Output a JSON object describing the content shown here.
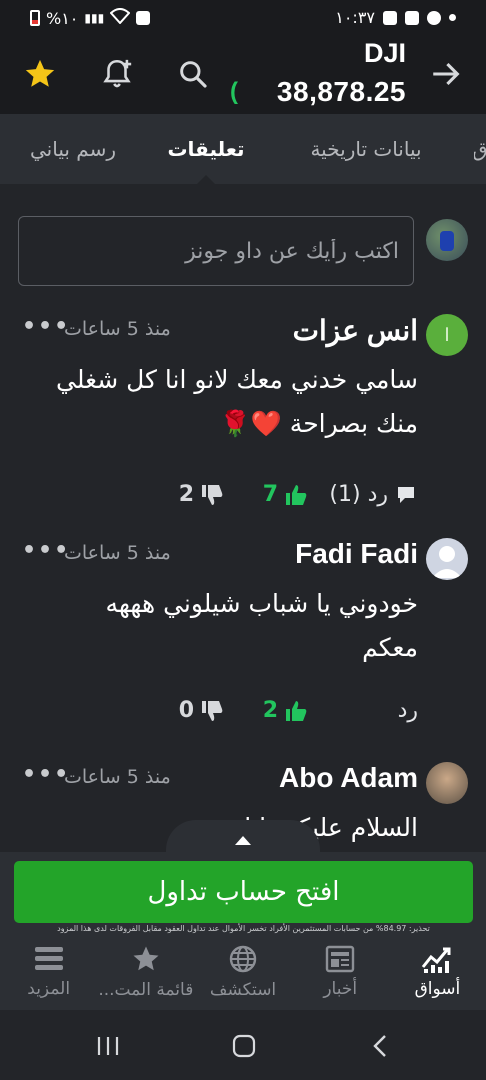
{
  "status_bar": {
    "time": "١٠:٣٧",
    "battery": "%١٠"
  },
  "header": {
    "instrument": "DJI",
    "price": "38,878.25",
    "price_indicator": "(",
    "colors": {
      "up": "#22c55e",
      "star": "#f5c518",
      "background": "#1a1b1e"
    },
    "icons": [
      "star-icon",
      "add-alert-bell-icon",
      "search-icon",
      "arrow-forward-icon"
    ]
  },
  "tabs": [
    {
      "label": "رسم بياني",
      "active": false
    },
    {
      "label": "تعليقات",
      "active": true
    },
    {
      "label": "بيانات تاريخية",
      "active": false
    },
    {
      "label": "ﻕ",
      "active": false
    }
  ],
  "comment_box": {
    "placeholder": "اكتب رأيك عن داو جونز"
  },
  "comments": [
    {
      "author": "انس عزات",
      "avatar_letter": "ا",
      "time": "منذ 5 ساعات",
      "more": "•••",
      "text": "سامي خدني معك لانو انا كل شغلي منك بصراحة ❤️🌹",
      "reply_label": "رد (1)",
      "likes": "7",
      "dislikes": "2"
    },
    {
      "author": "Fadi Fadi",
      "time": "منذ 5 ساعات",
      "more": "•••",
      "text": "خودوني يا شباب شيلوني هههه معكم",
      "reply_label": "رد",
      "likes": "2",
      "dislikes": "0"
    },
    {
      "author": "Abo Adam",
      "time": "منذ 5 ساعات",
      "more": "•••",
      "text": "السلام عليكم يا اخوتي"
    }
  ],
  "cta": {
    "label": "افتح حساب تداول",
    "disclaimer": "تحذير: 84.97% من حسابات المستثمرين الأفراد تخسر الأموال عند تداول العقود مقابل الفروقات لدى هذا المزود",
    "color": "#23a429"
  },
  "bottom_nav": [
    {
      "label": "أسواق",
      "icon": "markets-chart-icon",
      "active": true
    },
    {
      "label": "أخبار",
      "icon": "news-icon",
      "active": false
    },
    {
      "label": "استكشف",
      "icon": "globe-icon",
      "active": false
    },
    {
      "label": "قائمة المت...",
      "icon": "star-icon",
      "active": false
    },
    {
      "label": "المزيد",
      "icon": "menu-icon",
      "active": false
    }
  ]
}
